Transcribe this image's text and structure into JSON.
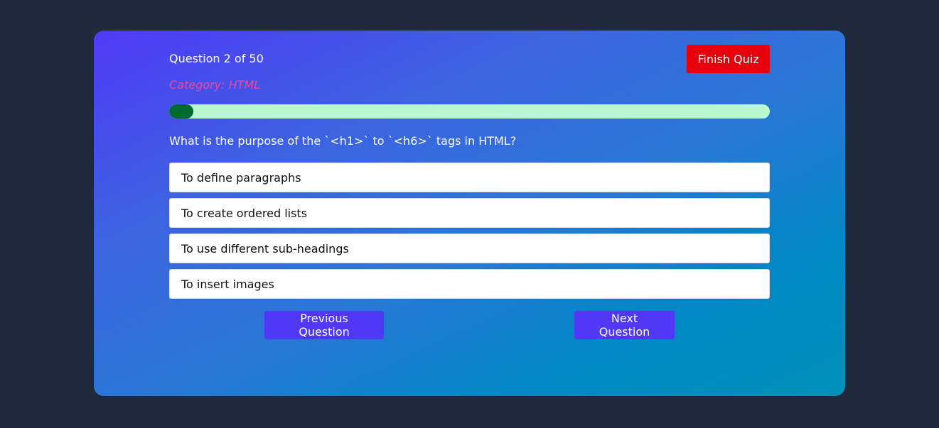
{
  "quiz": {
    "question_counter": "Question 2 of 50",
    "finish_label": "Finish Quiz",
    "category": "Category: HTML",
    "progress_fraction": 0.04,
    "question": "What is the purpose of the `<h1>` to `<h6>` tags in HTML?",
    "options": [
      "To define paragraphs",
      "To create ordered lists",
      "To use different sub-headings",
      "To insert images"
    ],
    "previous_label": "Previous Question",
    "next_label": "Next Question"
  },
  "colors": {
    "page_background": "#1e293b",
    "finish_button": "#e7000b",
    "nav_button": "#4f39f6",
    "category_text": "#ec4899",
    "progress_track": "#b9f8cf",
    "progress_fill": "#006b2e"
  }
}
